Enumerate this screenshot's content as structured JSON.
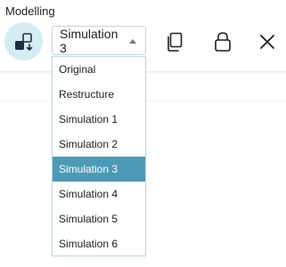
{
  "panel": {
    "title": "Modelling"
  },
  "select": {
    "value": "Simulation 3"
  },
  "dropdown": {
    "options": [
      "Original",
      "Restructure",
      "Simulation 1",
      "Simulation 2",
      "Simulation 3",
      "Simulation 4",
      "Simulation 5",
      "Simulation 6"
    ],
    "selected_index": 4
  },
  "icons": {
    "mode": "model-switch-icon",
    "copy": "copy-icon",
    "lock": "lock-icon",
    "close": "close-icon",
    "caret": "caret-up-icon"
  },
  "colors": {
    "mode_button_bg": "#d4ecf4",
    "selected_bg": "#4c9ab5",
    "dropdown_border": "#b8d8e3"
  }
}
